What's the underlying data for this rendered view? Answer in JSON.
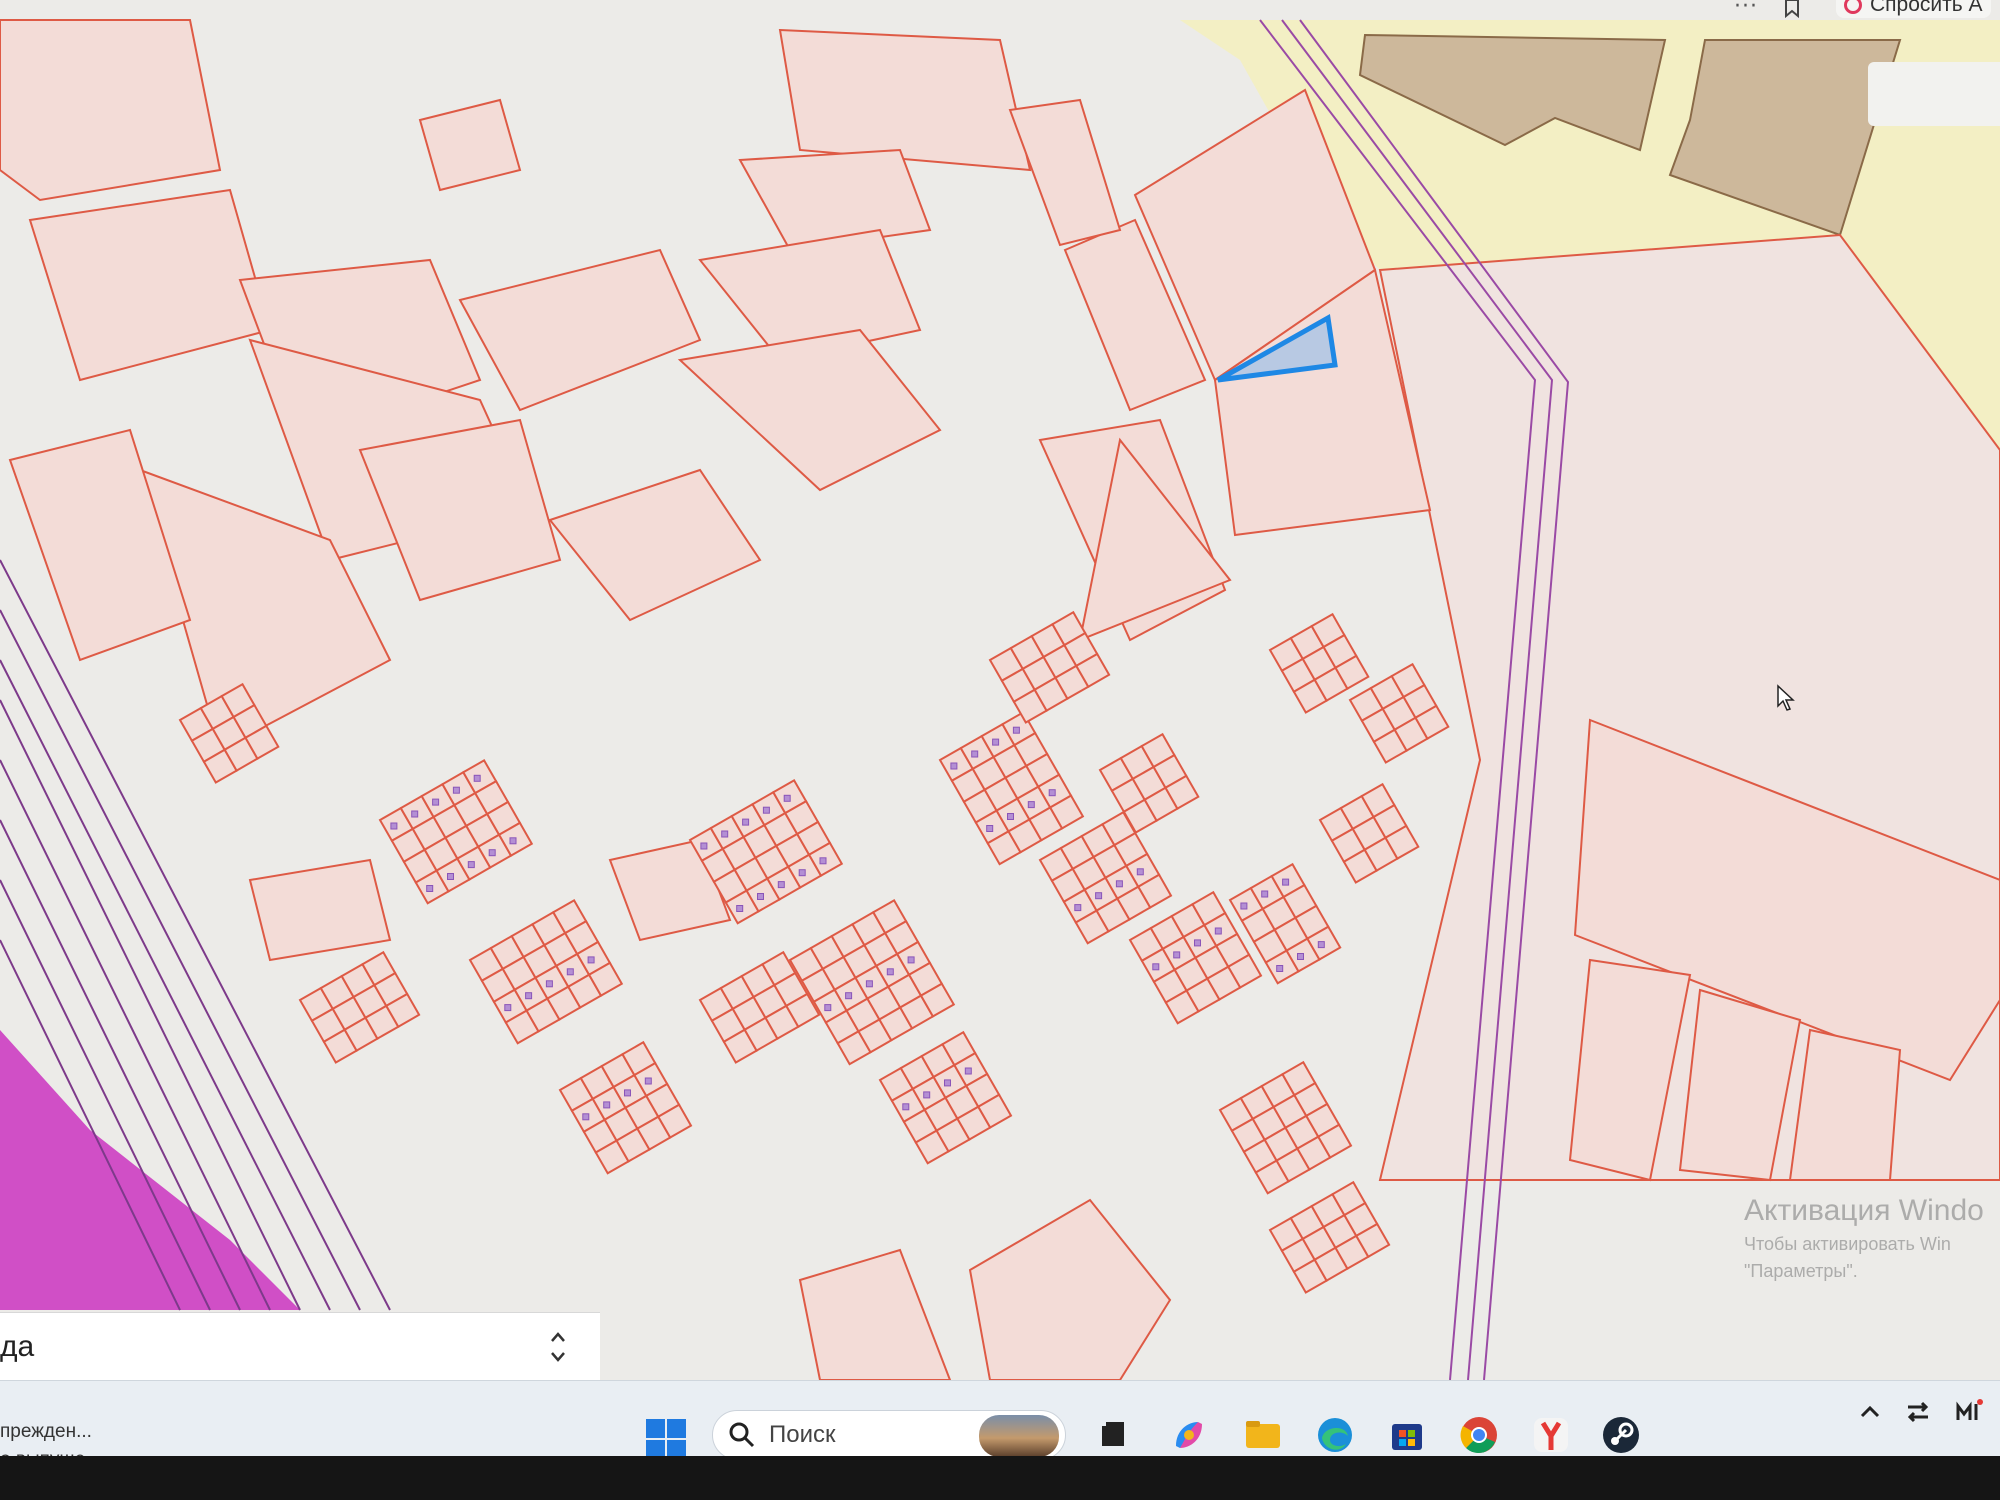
{
  "browser": {
    "more_label": "···",
    "ask_ai_label": "Спросить А"
  },
  "map": {
    "colors": {
      "background": "#ecebe8",
      "parcel_fill": "#f3dcd7",
      "parcel_stroke": "#de5a45",
      "selected_fill": "#9ec0e8",
      "selected_stroke": "#1e88e5",
      "building": "#b48fd4",
      "railway": "#7d3a8a",
      "zone_brown": "#cdb89b",
      "zone_yellow": "#f3efc4"
    },
    "selected_parcel": "selected-parcel"
  },
  "layer_select": {
    "value": "да"
  },
  "watermark": {
    "title": "Активация Windo",
    "line1": "Чтобы активировать Win",
    "line2": "\"Параметры\"."
  },
  "taskbar": {
    "notification_line1": "прежден...",
    "notification_line2": "о выпуще...",
    "search_placeholder": "Поиск",
    "apps": [
      "task-view",
      "copilot",
      "file-explorer",
      "edge",
      "microsoft-store",
      "chrome",
      "yandex-browser",
      "steam"
    ],
    "tray": [
      "chevron-up",
      "network-switch",
      "input-indicator"
    ]
  }
}
